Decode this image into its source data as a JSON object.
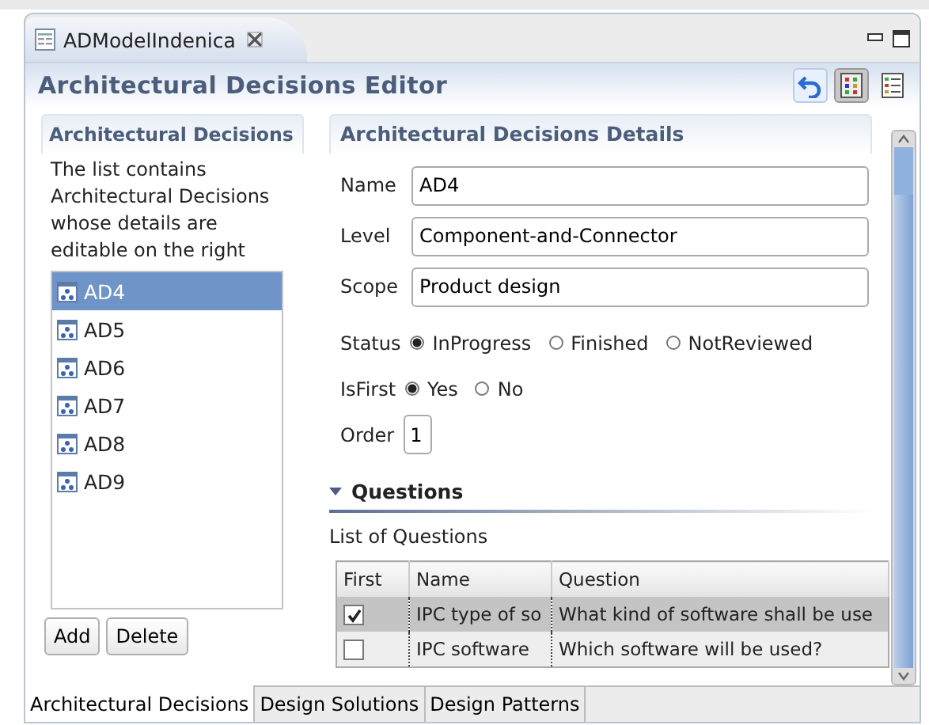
{
  "editor_tab": {
    "title": "ADModelIndenica"
  },
  "editor": {
    "title": "Architectural Decisions Editor",
    "toolbar": [
      {
        "kind": "undo",
        "selected": false
      },
      {
        "kind": "columns",
        "selected": true
      },
      {
        "kind": "list",
        "selected": false
      }
    ]
  },
  "decisions": {
    "title": "Architectural Decisions",
    "description": "The list contains Architectural Decisions whose details are editable on the right",
    "items": [
      {
        "label": "AD4",
        "selected": true
      },
      {
        "label": "AD5",
        "selected": false
      },
      {
        "label": "AD6",
        "selected": false
      },
      {
        "label": "AD7",
        "selected": false
      },
      {
        "label": "AD8",
        "selected": false
      },
      {
        "label": "AD9",
        "selected": false
      }
    ],
    "buttons": [
      "Add",
      "Delete"
    ]
  },
  "details": {
    "title": "Architectural Decisions Details",
    "fields": [
      {
        "label": "Name",
        "value": "AD4"
      },
      {
        "label": "Level",
        "value": "Component-and-Connector"
      },
      {
        "label": "Scope",
        "value": "Product design"
      }
    ],
    "status": {
      "label": "Status",
      "options": [
        {
          "label": "InProgress",
          "selected": true
        },
        {
          "label": "Finished",
          "selected": false
        },
        {
          "label": "NotReviewed",
          "selected": false
        }
      ]
    },
    "is_first": {
      "label": "IsFirst",
      "options": [
        {
          "label": "Yes",
          "selected": true
        },
        {
          "label": "No",
          "selected": false
        }
      ]
    },
    "order": {
      "label": "Order",
      "value": "1"
    }
  },
  "questions": {
    "title": "Questions",
    "expanded": true,
    "description": "List of Questions",
    "columns": [
      "First",
      "Name",
      "Question"
    ],
    "rows": [
      {
        "first": true,
        "name": "IPC type of so",
        "question": "What kind of software shall be use",
        "selected": true
      },
      {
        "first": false,
        "name": "IPC software",
        "question": "Which software will be used?",
        "selected": false
      }
    ]
  },
  "bottom_tabs": [
    {
      "label": "Architectural Decisions",
      "selected": true
    },
    {
      "label": "Design Solutions",
      "selected": false
    },
    {
      "label": "Design Patterns",
      "selected": false
    }
  ]
}
